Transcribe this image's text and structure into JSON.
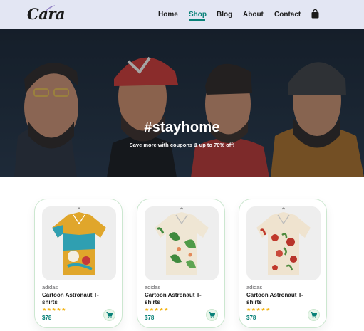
{
  "brand": {
    "logo_text": "Cara"
  },
  "nav": {
    "items": [
      {
        "label": "Home",
        "active": false
      },
      {
        "label": "Shop",
        "active": true
      },
      {
        "label": "Blog",
        "active": false
      },
      {
        "label": "About",
        "active": false
      },
      {
        "label": "Contact",
        "active": false
      }
    ],
    "bag_icon": "shopping-bag-icon"
  },
  "hero": {
    "title": "#stayhome",
    "subtitle": "Save more with coupons & up to 70% off!"
  },
  "colors": {
    "accent": "#088178",
    "header_bg": "#e3e6f3",
    "star": "#f3b519"
  },
  "products": [
    {
      "brand": "adidas",
      "name": "Cartoon Astronaut T-shirts",
      "stars": "★★★★★",
      "price": "$78",
      "shirt": "yellow-print"
    },
    {
      "brand": "adidas",
      "name": "Cartoon Astronaut T-shirts",
      "stars": "★★★★★",
      "price": "$78",
      "shirt": "tropical-green"
    },
    {
      "brand": "adidas",
      "name": "Cartoon Astronaut T-shirts",
      "stars": "★★★★★",
      "price": "$78",
      "shirt": "floral-red"
    }
  ]
}
